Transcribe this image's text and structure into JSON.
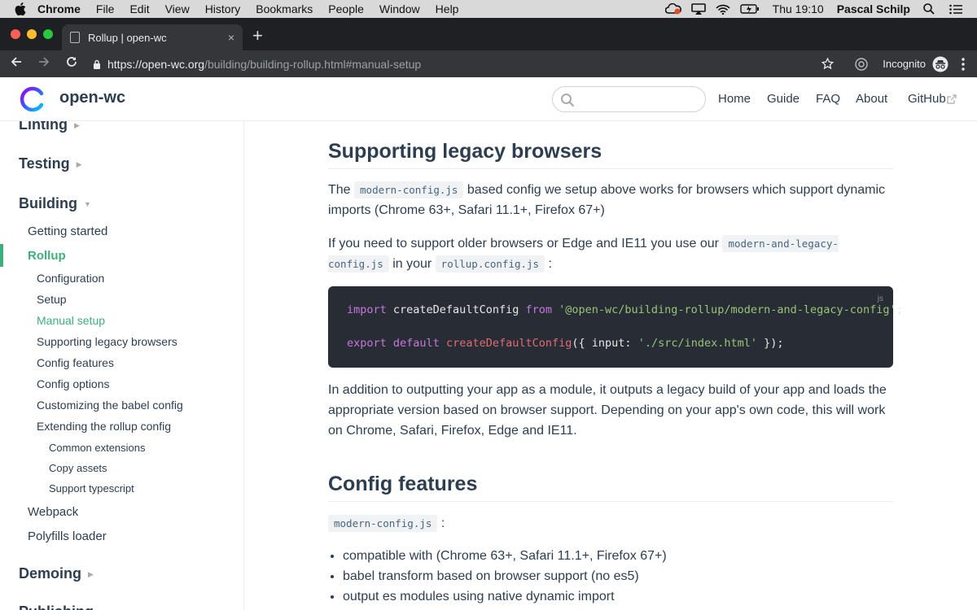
{
  "menubar": {
    "items": [
      "Chrome",
      "File",
      "Edit",
      "View",
      "History",
      "Bookmarks",
      "People",
      "Window",
      "Help"
    ],
    "clock": "Thu 19:10",
    "user": "Pascal Schilp"
  },
  "tab": {
    "title": "Rollup | open-wc",
    "close": "×",
    "new_tab": "+"
  },
  "address": {
    "host": "https://open-wc.org",
    "path": "/building/building-rollup.html#manual-setup",
    "incognito": "Incognito"
  },
  "site": {
    "brand": "open-wc",
    "nav": [
      "Home",
      "Guide",
      "FAQ",
      "About",
      "GitHub"
    ],
    "accent": "#3eaf7c"
  },
  "sidebar": {
    "groups": [
      "Linting",
      "Testing",
      "Building",
      "Demoing",
      "Publishing"
    ],
    "building_items": [
      "Getting started",
      "Rollup",
      "Webpack",
      "Polyfills loader"
    ],
    "rollup_items": [
      "Configuration",
      "Setup",
      "Manual setup",
      "Supporting legacy browsers",
      "Config features",
      "Config options",
      "Customizing the babel config",
      "Extending the rollup config"
    ],
    "extending_items": [
      "Common extensions",
      "Copy assets",
      "Support typescript"
    ]
  },
  "content": {
    "h_legacy": "Supporting legacy browsers",
    "p1_a": "The",
    "p1_code": "modern-config.js",
    "p1_b": "based config we setup above works for browsers which support dynamic imports (Chrome 63+, Safari 11.1+, Firefox 67+)",
    "p2_a": "If you need to support older browsers or Edge and IE11 you use our",
    "p2_code1": "modern-and-legacy-config.js",
    "p2_b": "in your",
    "p2_code2": "rollup.config.js",
    "p2_c": ":",
    "code": {
      "lang": "js",
      "l1_kw1": "import",
      "l1_id": " createDefaultConfig ",
      "l1_kw2": "from",
      "l1_sp": " ",
      "l1_str": "'@open-wc/building-rollup/modern-and-legacy-config'",
      "l1_end": ";",
      "l2_kw1": "export",
      "l2_sp1": " ",
      "l2_kw2": "default",
      "l2_sp2": " ",
      "l2_fn": "createDefaultConfig",
      "l2_mid": "({ input: ",
      "l2_str": "'./src/index.html'",
      "l2_end": " });"
    },
    "p3": "In addition to outputting your app as a module, it outputs a legacy build of your app and loads the appropriate version based on browser support. Depending on your app's own code, this will work on Chrome, Safari, Firefox, Edge and IE11.",
    "h_features": "Config features",
    "features_code": "modern-config.js",
    "features_colon": ":",
    "bullets": [
      "compatible with (Chrome 63+, Safari 11.1+, Firefox 67+)",
      "babel transform based on browser support (no es5)",
      "output es modules using native dynamic import"
    ]
  }
}
